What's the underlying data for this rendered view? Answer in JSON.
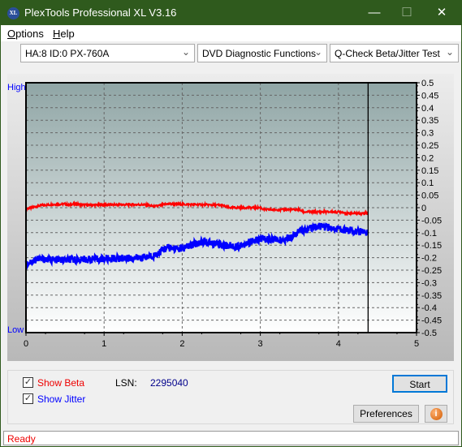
{
  "window": {
    "title": "PlexTools Professional XL V3.16",
    "logo_text": "XL"
  },
  "menu": [
    {
      "label": "Options",
      "key": "O",
      "rest": "ptions"
    },
    {
      "label": "Help",
      "key": "H",
      "rest": "elp"
    }
  ],
  "toolbar": {
    "drive": "HA:8 ID:0  PX-760A",
    "function": "DVD Diagnostic Functions",
    "test": "Q-Check Beta/Jitter Test"
  },
  "chart_data": {
    "type": "line",
    "xlim": [
      0,
      5
    ],
    "ylim": [
      -0.5,
      0.5
    ],
    "x_ticks": [
      "0",
      "1",
      "2",
      "3",
      "4",
      "5"
    ],
    "y_ticks": [
      "0.5",
      "0.45",
      "0.4",
      "0.35",
      "0.3",
      "0.25",
      "0.2",
      "0.15",
      "0.1",
      "0.05",
      "0",
      "-0.05",
      "-0.1",
      "-0.15",
      "-0.2",
      "-0.25",
      "-0.3",
      "-0.35",
      "-0.4",
      "-0.45",
      "-0.5"
    ],
    "left_labels": {
      "high": "High",
      "low": "Low"
    },
    "grid": true,
    "marker_x": 4.38,
    "series": [
      {
        "color": "#ff0000",
        "points": [
          [
            0,
            -0.005
          ],
          [
            0.2,
            0.01
          ],
          [
            0.5,
            0.015
          ],
          [
            0.55,
            0.01
          ],
          [
            0.6,
            0.015
          ],
          [
            0.8,
            0.01
          ],
          [
            1.0,
            0.012
          ],
          [
            1.5,
            0.012
          ],
          [
            1.65,
            0.005
          ],
          [
            1.8,
            0.015
          ],
          [
            2.5,
            0.01
          ],
          [
            2.6,
            0.0
          ],
          [
            3.0,
            0.0
          ],
          [
            3.05,
            -0.008
          ],
          [
            3.5,
            -0.008
          ],
          [
            3.55,
            -0.017
          ],
          [
            4.05,
            -0.017
          ],
          [
            4.1,
            -0.023
          ],
          [
            4.38,
            -0.022
          ]
        ]
      },
      {
        "color": "#0000ff",
        "points": [
          [
            0,
            -0.225
          ],
          [
            0.15,
            -0.205
          ],
          [
            0.5,
            -0.21
          ],
          [
            1.0,
            -0.205
          ],
          [
            1.5,
            -0.2
          ],
          [
            1.65,
            -0.19
          ],
          [
            1.8,
            -0.16
          ],
          [
            2.0,
            -0.165
          ],
          [
            2.25,
            -0.135
          ],
          [
            2.4,
            -0.145
          ],
          [
            2.7,
            -0.155
          ],
          [
            3.0,
            -0.125
          ],
          [
            3.3,
            -0.13
          ],
          [
            3.5,
            -0.095
          ],
          [
            3.75,
            -0.075
          ],
          [
            4.0,
            -0.085
          ],
          [
            4.38,
            -0.1
          ]
        ]
      }
    ]
  },
  "controls": {
    "show_beta": "Show Beta",
    "show_jitter": "Show Jitter",
    "beta_checked": true,
    "jitter_checked": true,
    "lsn_label": "LSN:",
    "lsn_value": "2295040",
    "start": "Start",
    "preferences": "Preferences"
  },
  "status": "Ready"
}
